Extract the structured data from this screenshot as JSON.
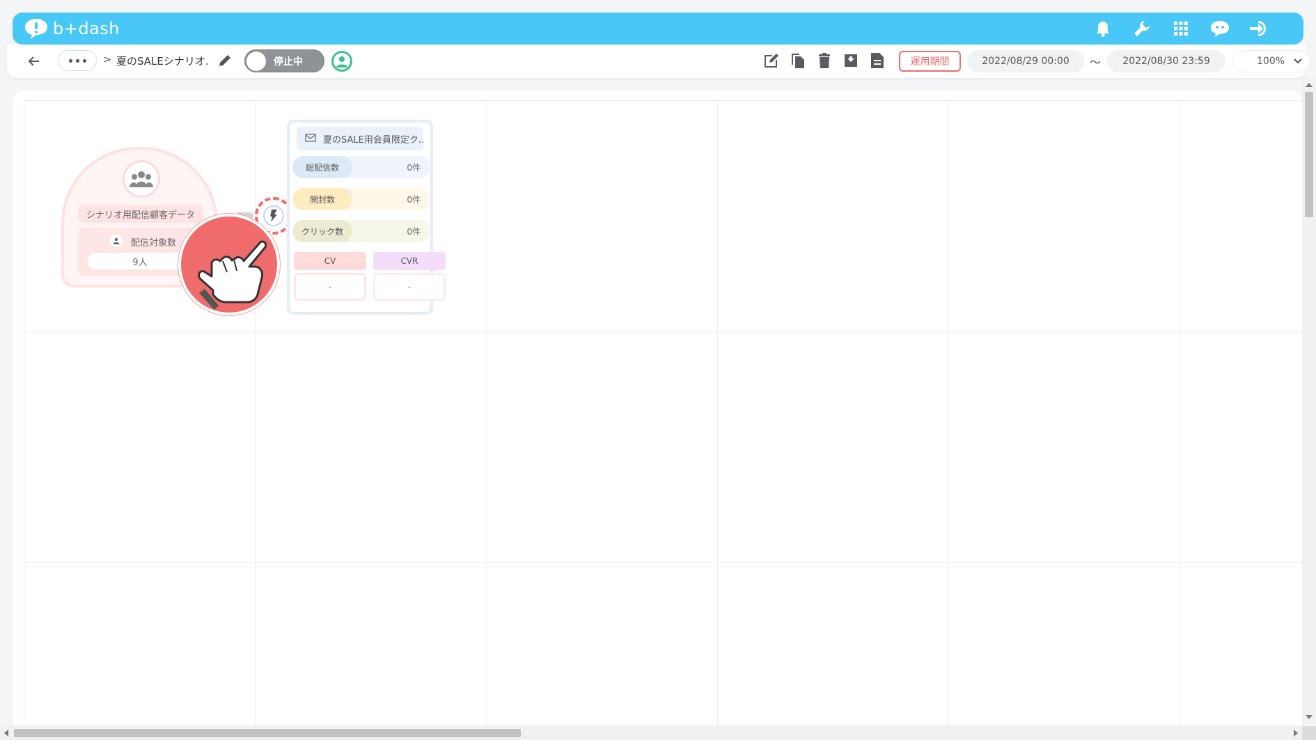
{
  "app": {
    "logo_text": "b+dash",
    "brand_color": "#49c7f7",
    "header_icons": [
      "bell-icon",
      "wrench-icon",
      "apps-grid-icon",
      "chat-bot-icon",
      "logout-icon"
    ]
  },
  "toolbar": {
    "breadcrumb_separator": ">",
    "scenario_title": "夏のSALEシナリオ.",
    "toggle_label": "停止中",
    "period_button": "運用期間",
    "date_from": "2022/08/29 00:00",
    "date_separator": "〜",
    "date_to": "2022/08/30 23:59",
    "zoom": "100%",
    "tool_icons": [
      "edit-note-icon",
      "copy-icon",
      "trash-icon",
      "archive-icon",
      "document-icon"
    ],
    "accent_color": "#f06b6b"
  },
  "segment_node": {
    "name": "シナリオ用配信顧客データ",
    "count_label": "配信対象数",
    "count_value": "9人"
  },
  "mail_node": {
    "title": "夏のSALE用会員限定ク…",
    "stats": [
      {
        "label": "総配信数",
        "value": "0件"
      },
      {
        "label": "開封数",
        "value": "0件"
      },
      {
        "label": "クリック数",
        "value": "0件"
      }
    ],
    "cv_label": "CV",
    "cvr_label": "CVR",
    "cv_value": "-",
    "cvr_value": "-"
  }
}
